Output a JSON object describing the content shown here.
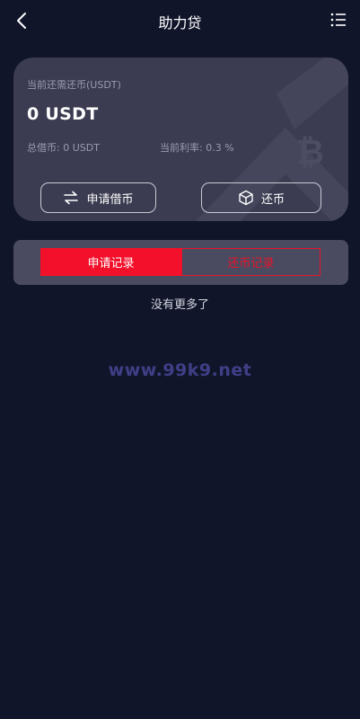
{
  "header": {
    "title": "助力贷",
    "back_icon": "chevron-left-icon",
    "menu_icon": "list-menu-icon"
  },
  "card": {
    "label": "当前还需还币(USDT)",
    "amount": "0 USDT",
    "total_borrowed": "总借币: 0 USDT",
    "current_rate": "当前利率: 0.3 %",
    "borrow_button": "申请借币",
    "repay_button": "还币",
    "borrow_icon": "swap-arrows-icon",
    "repay_icon": "cube-icon"
  },
  "tabs": {
    "apply": "申请记录",
    "repay": "还币记录",
    "active": "apply"
  },
  "list": {
    "empty_text": "没有更多了"
  },
  "watermark": "www.99k9.net",
  "colors": {
    "background": "#11152a",
    "card": "#3b3c51",
    "accent": "#f2102a"
  }
}
